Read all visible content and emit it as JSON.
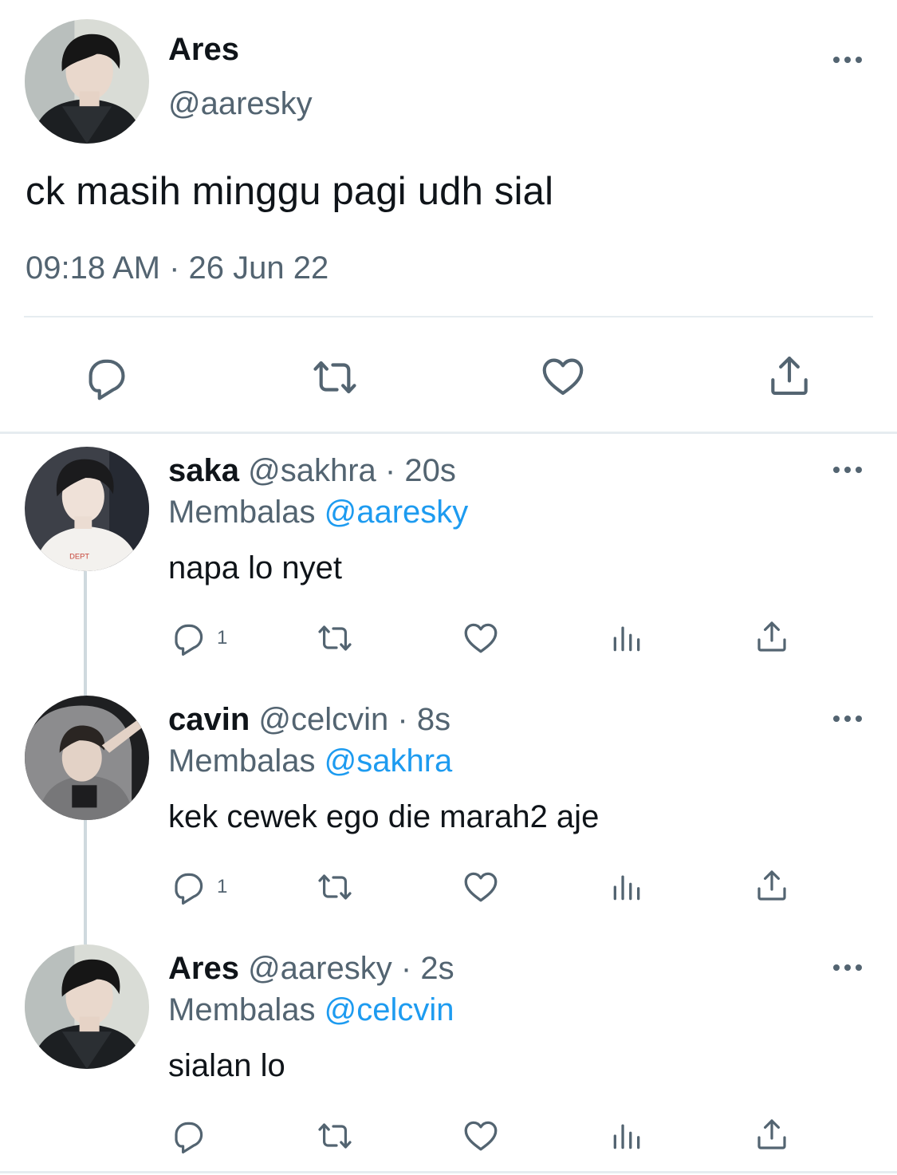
{
  "main_tweet": {
    "display_name": "Ares",
    "handle": "@aaresky",
    "text": "ck masih minggu pagi udh sial",
    "timestamp": "09:18 AM · 26 Jun 22"
  },
  "replies": [
    {
      "display_name": "saka",
      "handle": "@sakhra",
      "time": "20s",
      "replying_label": "Membalas",
      "replying_to": "@aaresky",
      "text": "napa lo nyet",
      "reply_count": "1"
    },
    {
      "display_name": "cavin",
      "handle": "@celcvin",
      "time": "8s",
      "replying_label": "Membalas",
      "replying_to": "@sakhra",
      "text": "kek cewek ego die marah2 aje",
      "reply_count": "1"
    },
    {
      "display_name": "Ares",
      "handle": "@aaresky",
      "time": "2s",
      "replying_label": "Membalas",
      "replying_to": "@celcvin",
      "text": "sialan lo",
      "reply_count": ""
    }
  ],
  "colors": {
    "text_primary": "#0f1419",
    "text_secondary": "#536471",
    "mention": "#1d9bf0",
    "divider": "#e6ecf0",
    "thread_line": "#cfd9de"
  }
}
